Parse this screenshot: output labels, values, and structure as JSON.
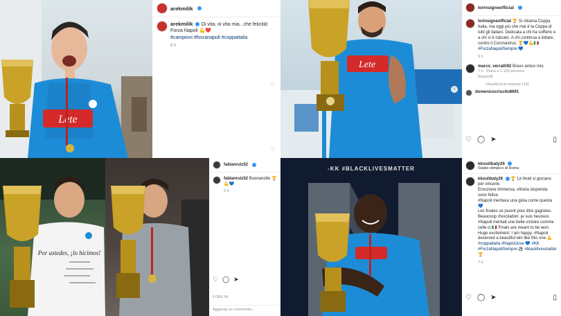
{
  "posts": {
    "milik": {
      "username": "arekmilik",
      "caption_text": "Oi vita, oi vita mia...che felicità! Forza Napoli 💪❤️",
      "hashtags": "#campioni #forzanapoli #coppaitalia",
      "time": "8 h",
      "jersey_sponsor": "Lete"
    },
    "insigne": {
      "username": "lorinsigneofficial",
      "caption_text": "🏆 Si chiama Coppa Italia, ma oggi più che mai è la Coppa di tutti gli italiani. Dedicata a chi ha sofferto e a chi si è rialzato. A chi continua a lottare, contro il Coronavirus. 🏆💙💪🇮🇹",
      "hashtags": "#ForzaNapoliSempre 💙",
      "time": "9 h",
      "comment": {
        "username": "marco_verratti92",
        "text": "Bravo amico mio",
        "time": "7 h",
        "likes": "Piace a 1.160 persone",
        "reply": "Rispondi"
      },
      "view_replies": "Visualizza le risposte (15)",
      "next_commenter": "domenicocriscito8691"
    },
    "ruiz": {
      "username": "fabianruiz52",
      "caption_text": "Buonanotte 🏆💪💙",
      "time": "5 h",
      "shirt_text": "Por ustedes, ¡lo hicimos!",
      "timestamp": "8 ORE FA",
      "add_comment": "Aggiungi un commento..."
    },
    "koulibaly": {
      "username": "kkoulibaly26",
      "location": "Stadio olimpico di Roma",
      "banner": "-KK #BLACKLIVESMATTER",
      "lines": [
        "🏆 Le finali si giocano per vincerle.",
        "Emozione immensa, vittoria stupenda: sono felice.",
        "#Napoli meritava una gioia come questa 💙",
        "Les finales se jouent pour être gagnées.",
        "Beaucoup d'excitation: je suis heureux.",
        "#Napoli méritait une belle victoire comme celle-ci 🇮🇹 Finals are meant to be won.",
        "Huge excitement: I am happy. #Napoli deserved a beautiful win like this one 💪",
        "#coppaitalia #NapoliJuve 💙 #KK #ForzaNapoliSempre ⚽ #blacklivesmatter 🏆"
      ],
      "time": "7 h"
    }
  },
  "icons": [
    "heart-icon",
    "comment-icon",
    "share-icon",
    "bookmark-icon"
  ],
  "colors": {
    "napoli_blue": "#1d8cd6",
    "link": "#00376b",
    "verified": "#3897f0",
    "trophy_gold": "#c9a227"
  }
}
